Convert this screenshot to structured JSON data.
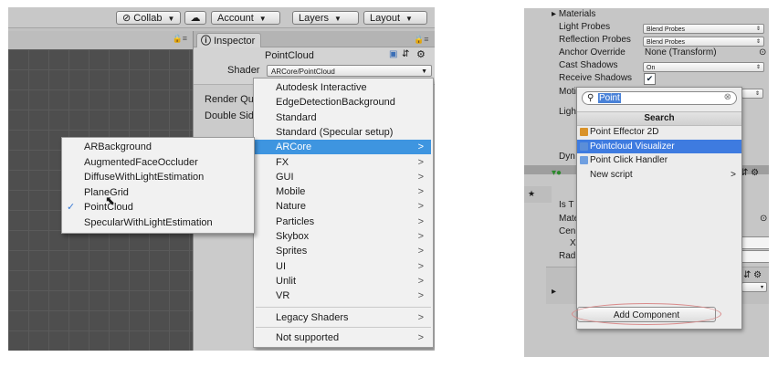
{
  "toolbar": {
    "collab": "Collab",
    "account": "Account",
    "layers": "Layers",
    "layout": "Layout"
  },
  "inspector": {
    "tab": "Inspector",
    "object_name": "PointCloud",
    "shader_label": "Shader",
    "shader_value": "ARCore/PointCloud",
    "render_queue_label": "Render Qu",
    "double_sided_label": "Double Sid"
  },
  "shader_menu": {
    "items": [
      {
        "label": "Autodesk Interactive",
        "sub": ""
      },
      {
        "label": "EdgeDetectionBackground",
        "sub": ""
      },
      {
        "label": "Standard",
        "sub": ""
      },
      {
        "label": "Standard (Specular setup)",
        "sub": ""
      },
      {
        "label": "ARCore",
        "sub": ">"
      },
      {
        "label": "FX",
        "sub": ">"
      },
      {
        "label": "GUI",
        "sub": ">"
      },
      {
        "label": "Mobile",
        "sub": ">"
      },
      {
        "label": "Nature",
        "sub": ">"
      },
      {
        "label": "Particles",
        "sub": ">"
      },
      {
        "label": "Skybox",
        "sub": ">"
      },
      {
        "label": "Sprites",
        "sub": ">"
      },
      {
        "label": "UI",
        "sub": ">"
      },
      {
        "label": "Unlit",
        "sub": ">"
      },
      {
        "label": "VR",
        "sub": ">"
      }
    ],
    "legacy": "Legacy Shaders",
    "not_supported": "Not supported",
    "sub_arrow": ">"
  },
  "arcore_submenu": {
    "items": [
      "ARBackground",
      "AugmentedFaceOccluder",
      "DiffuseWithLightEstimation",
      "PlaneGrid",
      "PointCloud",
      "SpecularWithLightEstimation"
    ],
    "checked_glyph": "✓"
  },
  "right_inspector": {
    "materials": "Materials",
    "light_probes": "Light Probes",
    "light_probes_value": "Blend Probes",
    "reflection_probes": "Reflection Probes",
    "reflection_probes_value": "Blend Probes",
    "anchor_override": "Anchor Override",
    "anchor_override_value": "None (Transform)",
    "cast_shadows": "Cast Shadows",
    "cast_shadows_value": "On",
    "receive_shadows": "Receive Shadows",
    "moti": "Moti",
    "ligh": "Ligh",
    "dyn": "Dyn",
    "is_t": "Is T",
    "mate": "Mate",
    "cen": "Cen",
    "x": "X",
    "rad": "Rad"
  },
  "add_component": {
    "search_value": "Point",
    "header": "Search",
    "results": [
      {
        "label": "Point Effector 2D",
        "sub": ""
      },
      {
        "label": "Pointcloud Visualizer",
        "sub": ""
      },
      {
        "label": "Point Click Handler",
        "sub": ""
      },
      {
        "label": "New script",
        "sub": ">"
      }
    ],
    "button": "Add Component"
  },
  "colors": {
    "selection": "#3e95e0",
    "highlight_ellipse": "#d98a8a"
  }
}
